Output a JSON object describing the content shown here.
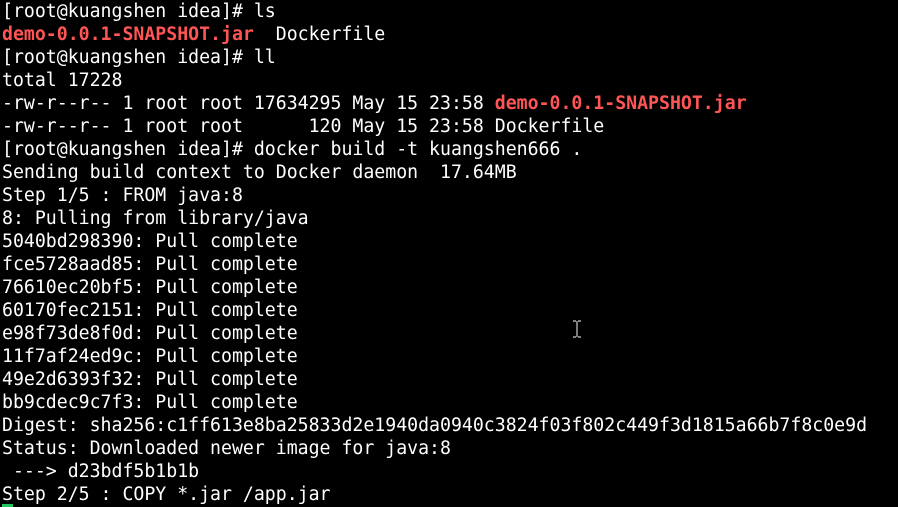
{
  "colors": {
    "background": "#000000",
    "text": "#ffffff",
    "highlight": "#ff5555",
    "cursor": "#22c55e"
  },
  "lines": [
    [
      {
        "text": "[root@kuangshen idea]# ls"
      }
    ],
    [
      {
        "text": "demo-0.0.1-SNAPSHOT.jar",
        "color": "red"
      },
      {
        "text": "  Dockerfile"
      }
    ],
    [
      {
        "text": "[root@kuangshen idea]# ll"
      }
    ],
    [
      {
        "text": "total 17228"
      }
    ],
    [
      {
        "text": "-rw-r--r-- 1 root root 17634295 May 15 23:58 "
      },
      {
        "text": "demo-0.0.1-SNAPSHOT.jar",
        "color": "red"
      }
    ],
    [
      {
        "text": "-rw-r--r-- 1 root root      120 May 15 23:58 Dockerfile"
      }
    ],
    [
      {
        "text": "[root@kuangshen idea]# docker build -t kuangshen666 ."
      }
    ],
    [
      {
        "text": "Sending build context to Docker daemon  17.64MB"
      }
    ],
    [
      {
        "text": "Step 1/5 : FROM java:8"
      }
    ],
    [
      {
        "text": "8: Pulling from library/java"
      }
    ],
    [
      {
        "text": "5040bd298390: Pull complete"
      }
    ],
    [
      {
        "text": "fce5728aad85: Pull complete"
      }
    ],
    [
      {
        "text": "76610ec20bf5: Pull complete"
      }
    ],
    [
      {
        "text": "60170fec2151: Pull complete"
      }
    ],
    [
      {
        "text": "e98f73de8f0d: Pull complete"
      }
    ],
    [
      {
        "text": "11f7af24ed9c: Pull complete"
      }
    ],
    [
      {
        "text": "49e2d6393f32: Pull complete"
      }
    ],
    [
      {
        "text": "bb9cdec9c7f3: Pull complete"
      }
    ],
    [
      {
        "text": "Digest: sha256:c1ff613e8ba25833d2e1940da0940c3824f03f802c449f3d1815a66b7f8c0e9d"
      }
    ],
    [
      {
        "text": "Status: Downloaded newer image for java:8"
      }
    ],
    [
      {
        "text": " ---> d23bdf5b1b1b"
      }
    ],
    [
      {
        "text": "Step 2/5 : COPY *.jar /app.jar"
      }
    ]
  ],
  "pointer_icon": "i-beam-icon"
}
